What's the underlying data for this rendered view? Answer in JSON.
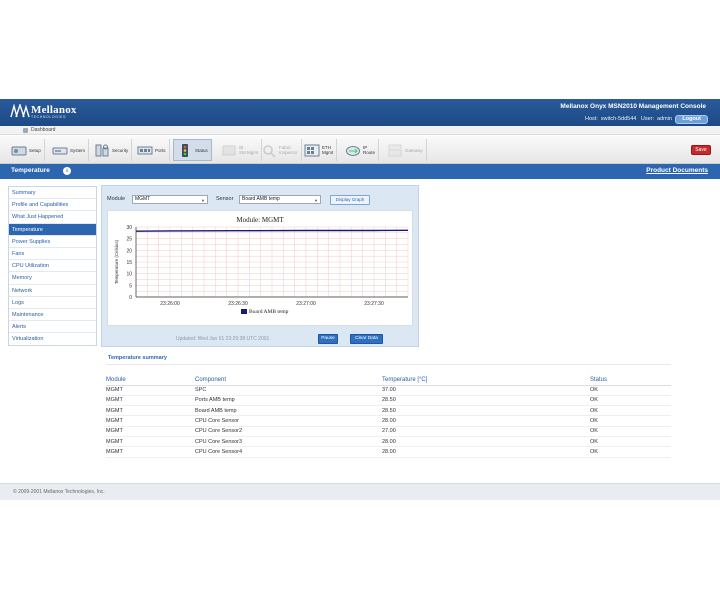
{
  "header": {
    "logo_text": "Mellanox",
    "logo_subtext": "TECHNOLOGIES",
    "console_title": "Mellanox Onyx MSN2010 Management Console",
    "host_label": "Host:",
    "host_value": "switch-5dd544",
    "user_label": "User:",
    "user_value": "admin",
    "logout_label": "Logout"
  },
  "dashboard": {
    "label": "Dashboard"
  },
  "toolbar": {
    "items": [
      {
        "label": "Setup",
        "icon": "setup-icon",
        "enabled": true
      },
      {
        "label": "System",
        "icon": "system-icon",
        "enabled": true
      },
      {
        "label": "Security",
        "icon": "security-icon",
        "enabled": true
      },
      {
        "label": "Ports",
        "icon": "ports-icon",
        "enabled": true
      },
      {
        "label": "Status",
        "icon": "status-icon",
        "enabled": true,
        "active": true
      },
      {
        "label": "IB\nSM Mgmt",
        "icon": "ib-sm-icon",
        "enabled": false
      },
      {
        "label": "Fabric\nInspector",
        "icon": "fabric-inspector-icon",
        "enabled": false
      },
      {
        "label": "ETH\nMgmt",
        "icon": "eth-mgmt-icon",
        "enabled": true
      },
      {
        "label": "IP\nRoute",
        "icon": "ip-route-icon",
        "enabled": true
      },
      {
        "label": "Gateway",
        "icon": "gateway-icon",
        "enabled": false
      }
    ],
    "save_label": "Save"
  },
  "section": {
    "title": "Temperature",
    "product_docs": "Product Documents"
  },
  "sidebar": {
    "items": [
      {
        "label": "Summary"
      },
      {
        "label": "Profile and Capabilities"
      },
      {
        "label": "What Just Happened"
      },
      {
        "label": "Temperature",
        "active": true
      },
      {
        "label": "Power Supplies"
      },
      {
        "label": "Fans"
      },
      {
        "label": "CPU Utilization"
      },
      {
        "label": "Memory"
      },
      {
        "label": "Network"
      },
      {
        "label": "Logs"
      },
      {
        "label": "Maintenance"
      },
      {
        "label": "Alerts"
      },
      {
        "label": "Virtualization"
      }
    ]
  },
  "controls": {
    "module_label": "Module",
    "module_value": "MGMT",
    "sensor_label": "Sensor",
    "sensor_value": "Board AMB temp",
    "display_graph_label": "Display Graph",
    "updated_text": "Updated: Wed Jan 01 23:29:38 UTC 2001",
    "pause_label": "Pause",
    "clear_label": "Clear Data"
  },
  "chart_data": {
    "type": "line",
    "title": "Module: MGMT",
    "ylabel": "Temperature (Celsius)",
    "xlabel": "",
    "ylim": [
      0,
      30
    ],
    "yticks": [
      0,
      5,
      10,
      15,
      20,
      25,
      30
    ],
    "xticks": [
      "23:26:00",
      "23:26:30",
      "23:27:00",
      "23:27:30"
    ],
    "x": [
      "23:25:45",
      "23:26:00",
      "23:26:30",
      "23:27:00",
      "23:27:30",
      "23:27:45"
    ],
    "series": [
      {
        "name": "Board AMB temp",
        "color": "#1a1a6e",
        "values": [
          28.2,
          28.3,
          28.4,
          28.5,
          28.5,
          28.6
        ]
      }
    ],
    "grid": true,
    "legend": "bottom-center"
  },
  "summary": {
    "title": "Temperature summary",
    "columns": [
      "Module",
      "Component",
      "Temperature [°C]",
      "Status"
    ],
    "rows": [
      [
        "MGMT",
        "SPC",
        "37.00",
        "OK"
      ],
      [
        "MGMT",
        "Ports AMB temp",
        "28.50",
        "OK"
      ],
      [
        "MGMT",
        "Board AMB temp",
        "28.50",
        "OK"
      ],
      [
        "MGMT",
        "CPU Core Sensor",
        "28.00",
        "OK"
      ],
      [
        "MGMT",
        "CPU Core Sensor2",
        "27.00",
        "OK"
      ],
      [
        "MGMT",
        "CPU Core Sensor3",
        "28.00",
        "OK"
      ],
      [
        "MGMT",
        "CPU Core Sensor4",
        "28.00",
        "OK"
      ]
    ]
  },
  "footer": {
    "copyright": "© 2009-2001 Mellanox Technologies, Inc."
  }
}
